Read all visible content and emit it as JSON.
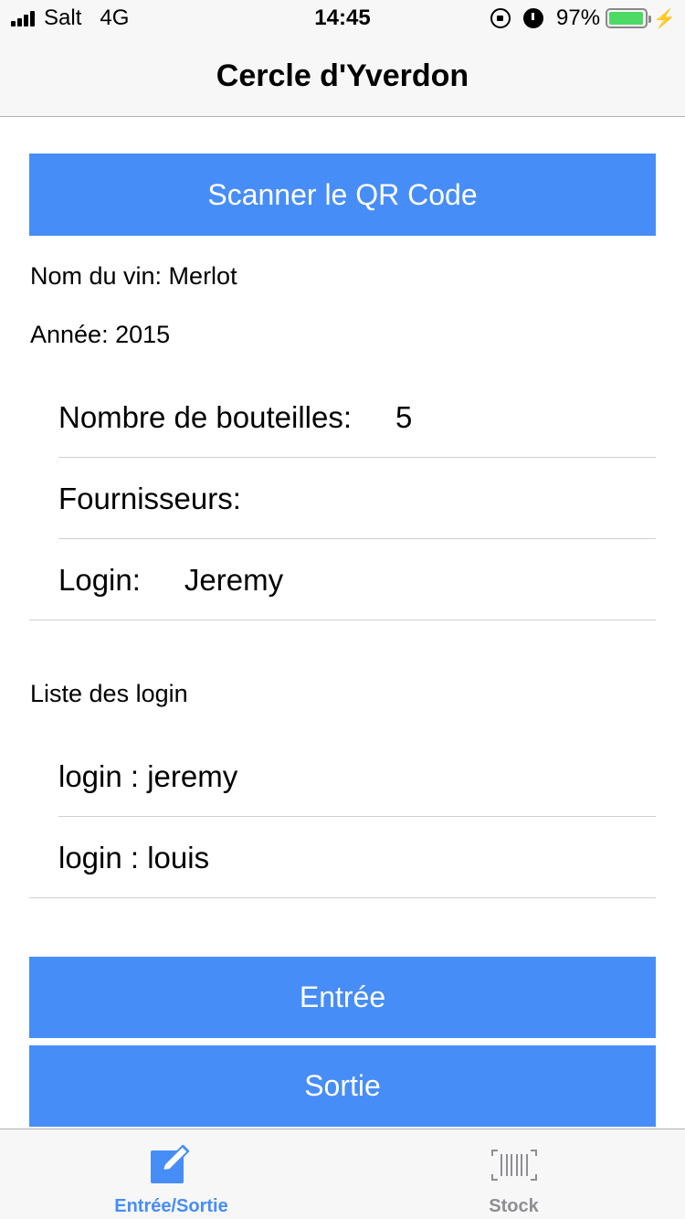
{
  "status_bar": {
    "carrier": "Salt",
    "network": "4G",
    "time": "14:45",
    "battery": "97%",
    "battery_level": 0.97,
    "battery_color": "#4cd964",
    "icons": [
      "signal-icon",
      "rotation-lock-icon",
      "alarm-icon",
      "battery-icon",
      "charging-bolt-icon"
    ]
  },
  "nav": {
    "title": "Cercle d'Yverdon"
  },
  "accent_color": "#478df7",
  "scan_button": "Scanner le QR Code",
  "wine": {
    "name_line": "Nom du vin: Merlot",
    "year_line": "Année: 2015"
  },
  "form": {
    "bottles_label": "Nombre de bouteilles:",
    "bottles_value": "5",
    "suppliers_label": "Fournisseurs:",
    "suppliers_value": "",
    "login_label": "Login:",
    "login_value": "Jeremy"
  },
  "login_list": {
    "title": "Liste des login",
    "items": [
      "login : jeremy",
      "login : louis"
    ]
  },
  "actions": {
    "entree": "Entrée",
    "sortie": "Sortie"
  },
  "tabs": [
    {
      "label": "Entrée/Sortie",
      "icon": "edit-icon",
      "active": true,
      "color": "#478df7"
    },
    {
      "label": "Stock",
      "icon": "barcode-icon",
      "active": false,
      "color": "#8e8e93"
    }
  ]
}
